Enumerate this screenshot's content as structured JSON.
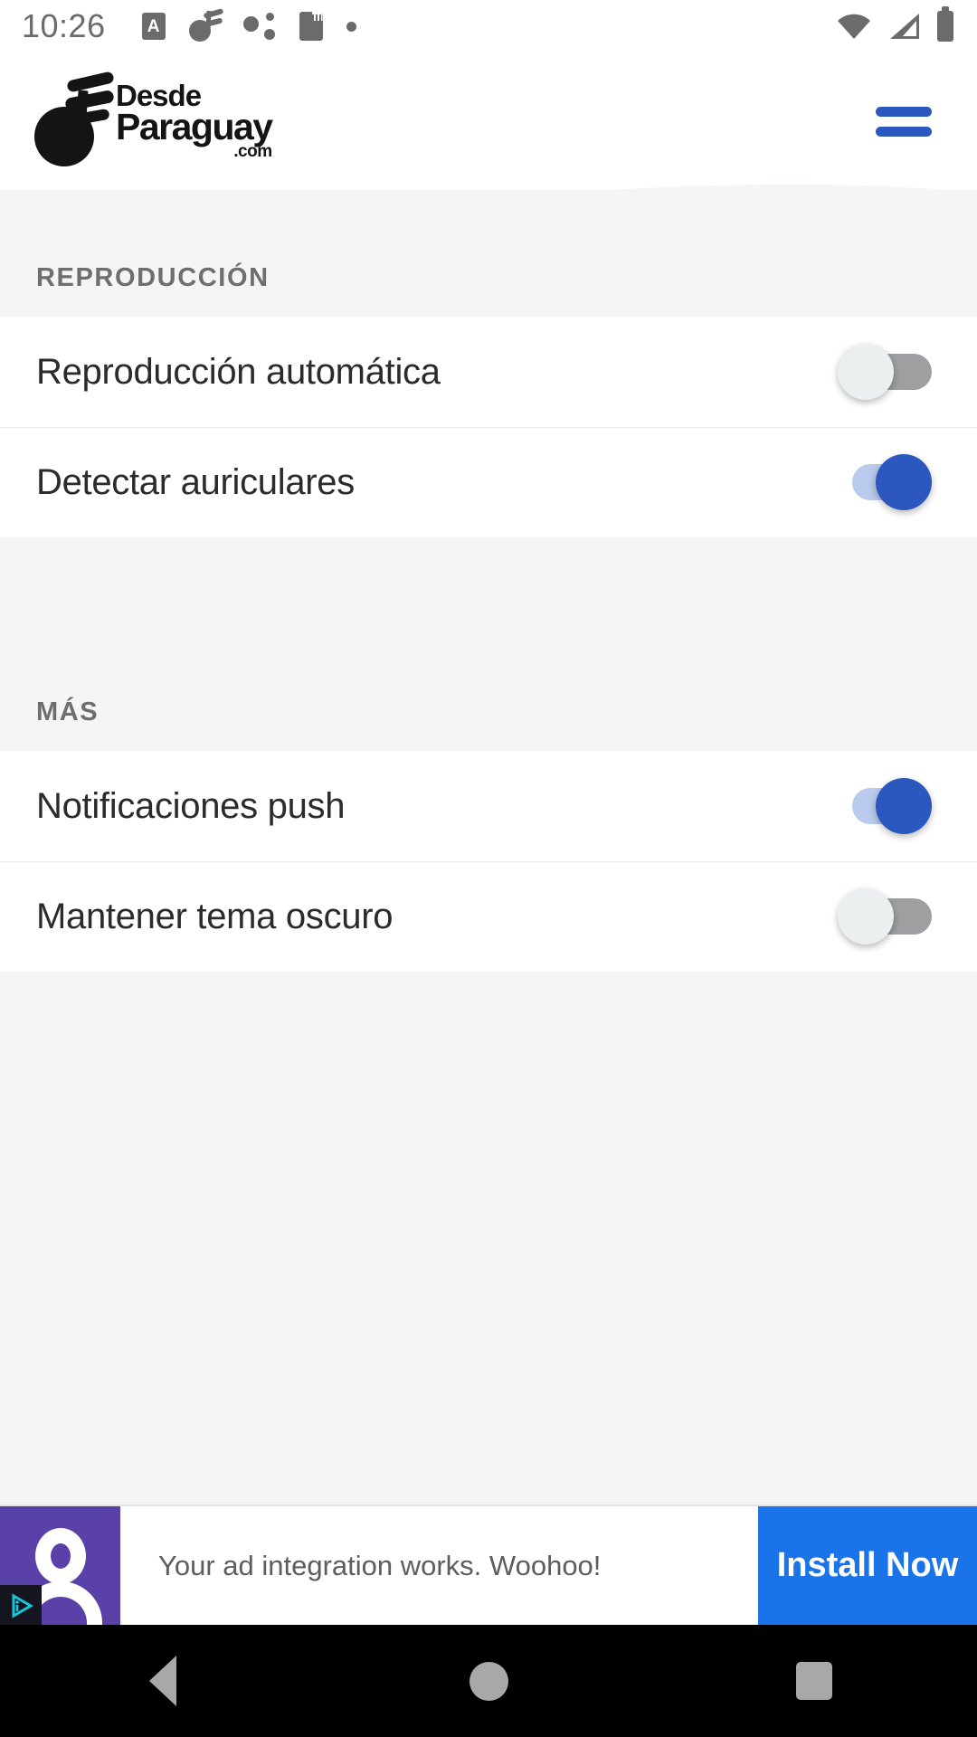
{
  "status_bar": {
    "time": "10:26",
    "notification_icons": [
      "app-badge-icon",
      "music-note-icon",
      "bluetooth-dots-icon",
      "sd-card-icon",
      "dot-icon"
    ],
    "right_icons": [
      "wifi-icon",
      "cellular-signal-icon",
      "battery-icon"
    ],
    "app_badge_letter": "A"
  },
  "header": {
    "logo": {
      "line1": "Desde",
      "line2": "Paraguay",
      "line3": ".com",
      "mark": "flag-ball-logo-icon"
    },
    "menu_icon": "hamburger-menu-icon"
  },
  "settings": {
    "groups": [
      {
        "title": "REPRODUCCIÓN",
        "rows": [
          {
            "label": "Reproducción automática",
            "state": "off"
          },
          {
            "label": "Detectar auriculares",
            "state": "on"
          }
        ]
      },
      {
        "title": "MÁS",
        "rows": [
          {
            "label": "Notificaciones push",
            "state": "on"
          },
          {
            "label": "Mantener tema oscuro",
            "state": "off"
          }
        ]
      }
    ]
  },
  "ad_banner": {
    "icon": "avatar-person-icon",
    "adchoices_icon": "adchoices-icon",
    "text": "Your ad integration works. Woohoo!",
    "cta_label": "Install Now"
  },
  "nav_bar": {
    "back": "back-triangle-icon",
    "home": "home-circle-icon",
    "recents": "recents-square-icon"
  },
  "colors": {
    "accent_blue": "#2b57bf",
    "track_on": "#b9caec",
    "track_off": "#9e9fa1",
    "cta_blue": "#1a73e8",
    "page_bg": "#f4f5f6",
    "card_bg": "#ffffff",
    "group_title": "#6e6e6e",
    "row_label": "#2b2b2b",
    "ad_icon_bg": "#5a41a8"
  }
}
